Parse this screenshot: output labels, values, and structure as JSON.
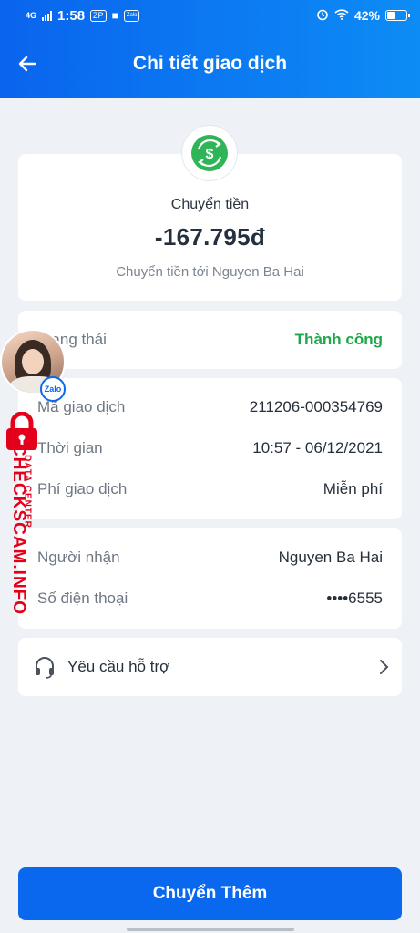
{
  "status_bar": {
    "network": "4G",
    "time": "1:58",
    "notif_icons": [
      "ZP",
      "Zalo"
    ],
    "battery": "42%",
    "battery_level": 0.42
  },
  "header": {
    "title": "Chi tiết giao dịch"
  },
  "summary": {
    "type_label": "Chuyển tiền",
    "amount": "-167.795đ",
    "description": "Chuyển tiền tới Nguyen Ba Hai"
  },
  "status": {
    "label": "Trạng thái",
    "value": "Thành công",
    "color": "#1ea84a"
  },
  "details": [
    {
      "label": "Mã giao dịch",
      "value": "211206-000354769"
    },
    {
      "label": "Thời gian",
      "value": "10:57 - 06/12/2021"
    },
    {
      "label": "Phí giao dịch",
      "value": "Miễn phí"
    }
  ],
  "contact": [
    {
      "label": "Người nhận",
      "value": "Nguyen Ba Hai"
    },
    {
      "label": "Số điện thoại",
      "value": "••••6555"
    }
  ],
  "support": {
    "label": "Yêu cầu hỗ trợ",
    "icon": "headset-icon"
  },
  "cta": {
    "label": "Chuyển Thêm",
    "color": "#0a68ef"
  },
  "watermark": {
    "badge": "Zalo",
    "main": "CHECKSCAM.INFO",
    "sub": "DATA CENTER",
    "color": "#e4001b"
  }
}
